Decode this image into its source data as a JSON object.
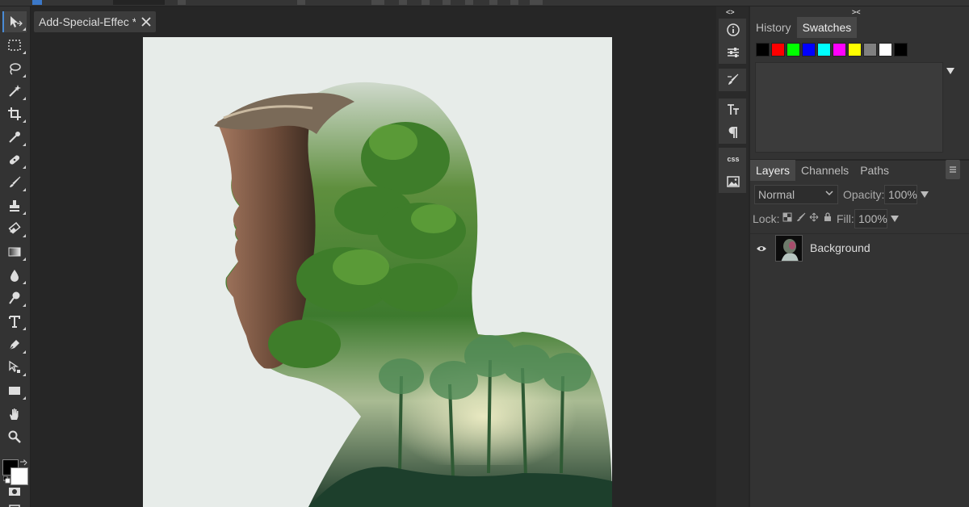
{
  "document": {
    "tab_title": "Add-Special-Effec *"
  },
  "toolbar": {
    "tools": [
      "move-tool",
      "marquee-tool",
      "lasso-tool",
      "magic-wand-tool",
      "crop-tool",
      "eyedropper-tool",
      "healing-tool",
      "brush-tool",
      "stamp-tool",
      "eraser-tool",
      "gradient-tool",
      "blur-tool",
      "dodge-tool",
      "type-tool",
      "pen-tool",
      "path-select-tool",
      "shape-tool",
      "hand-tool",
      "zoom-tool"
    ],
    "active_tool": "move-tool",
    "foreground_color": "#000000",
    "background_color": "#ffffff"
  },
  "mini_panel": {
    "collapse_label": "<>",
    "css_label": "css"
  },
  "panels": {
    "collapse_label": "><",
    "top_tabs": [
      {
        "label": "History",
        "active": false
      },
      {
        "label": "Swatches",
        "active": true
      }
    ],
    "swatches": [
      "#000000",
      "#ff0000",
      "#00ff00",
      "#0000ff",
      "#00ffff",
      "#ff00ff",
      "#ffff00",
      "#808080",
      "#ffffff",
      "#000000"
    ],
    "layer_tabs": [
      {
        "label": "Layers",
        "active": true
      },
      {
        "label": "Channels",
        "active": false
      },
      {
        "label": "Paths",
        "active": false
      }
    ],
    "blend_mode": "Normal",
    "opacity_label": "Opacity:",
    "opacity_value": "100%",
    "lock_label": "Lock:",
    "fill_label": "Fill:",
    "fill_value": "100%",
    "layers": [
      {
        "name": "Background",
        "visible": true
      }
    ]
  },
  "colors": {
    "accent": "#4a8bd6",
    "panel_bg": "#333333",
    "workspace_bg": "#262626"
  }
}
